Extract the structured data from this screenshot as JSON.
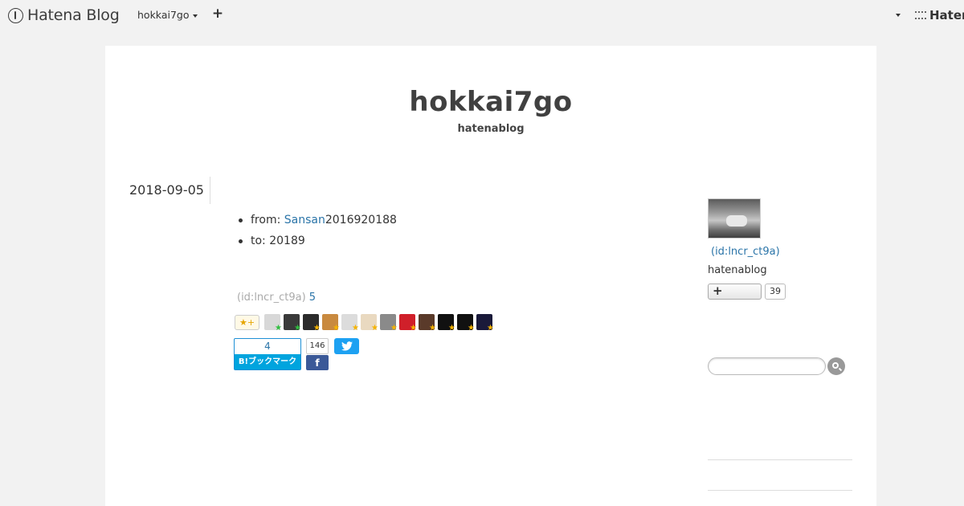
{
  "navbar": {
    "logo_text": "Hatena Blog",
    "blog_switch": "hokkai7go",
    "add_label": "+",
    "brand_text": "Hater"
  },
  "blog": {
    "title": "hokkai7go",
    "description": "hatenablog"
  },
  "entry": {
    "date": "2018-09-05",
    "items": [
      {
        "prefix": "from: ",
        "link": "Sansan",
        "suffix": "2016920188"
      },
      {
        "prefix": "to: 20189",
        "link": "",
        "suffix": ""
      }
    ],
    "star_author": "(id:lncr_ct9a)",
    "star_count": "5",
    "star_add_label": "★+",
    "star_avatars": [
      {
        "name": "avatar-1",
        "color": "#d8d8d8",
        "star": "green"
      },
      {
        "name": "avatar-2",
        "color": "#3a3a3a",
        "star": "green"
      },
      {
        "name": "avatar-3",
        "color": "#2b2b2b",
        "star": "yellow"
      },
      {
        "name": "avatar-4",
        "color": "#c98a3f",
        "star": "yellow"
      },
      {
        "name": "avatar-5",
        "color": "#dcdcdc",
        "star": "yellow"
      },
      {
        "name": "avatar-6",
        "color": "#e9d9c0",
        "star": "yellow"
      },
      {
        "name": "avatar-7",
        "color": "#8a8a8a",
        "star": "yellow"
      },
      {
        "name": "avatar-8",
        "color": "#d0202a",
        "star": "yellow"
      },
      {
        "name": "avatar-9",
        "color": "#5a3a2a",
        "star": "yellow"
      },
      {
        "name": "avatar-10",
        "color": "#111111",
        "star": "yellow"
      },
      {
        "name": "avatar-11",
        "color": "#111111",
        "star": "yellow"
      },
      {
        "name": "avatar-12",
        "color": "#1a1a3a",
        "star": "yellow"
      }
    ],
    "hatebu_count": "4",
    "hatebu_label": "B!ブックマーク",
    "fb_count": "146",
    "fb_icon": "f",
    "twitter_icon": "twitter-bird"
  },
  "sidebar": {
    "profile_id": "(id:lncr_ct9a)",
    "profile_desc": "hatenablog",
    "follow_label": "+",
    "follow_count": "39",
    "search_placeholder": ""
  },
  "colors": {
    "link": "#2a74a8",
    "hatebu": "#00a4de",
    "facebook": "#3b5998",
    "twitter": "#1da1f2"
  }
}
